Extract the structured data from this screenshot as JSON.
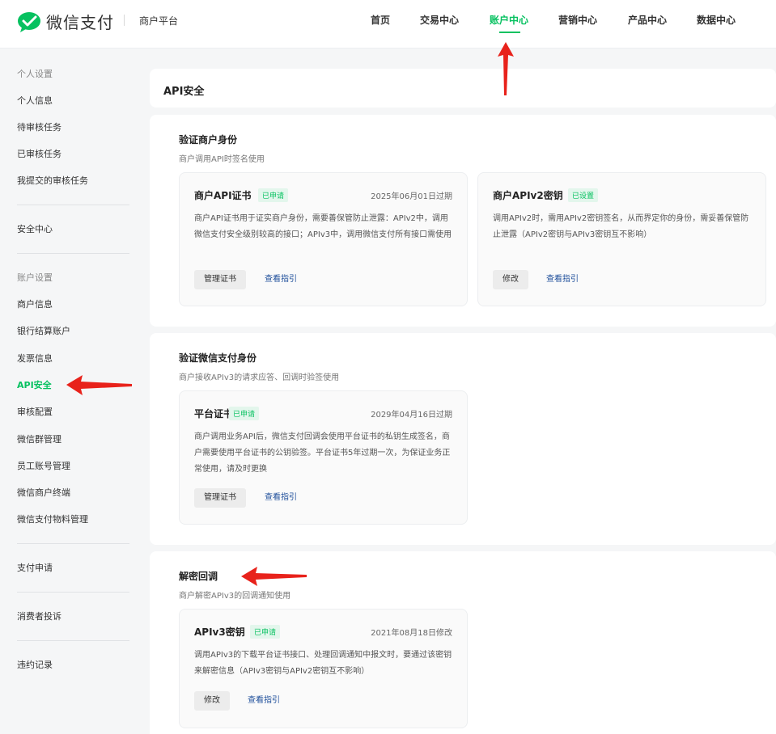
{
  "brand": {
    "logo_text": "微信支付",
    "sub_title": "商户平台"
  },
  "nav": {
    "items": [
      "首页",
      "交易中心",
      "账户中心",
      "营销中心",
      "产品中心",
      "数据中心"
    ],
    "active": "账户中心"
  },
  "sidebar": {
    "personal_group": "个人设置",
    "personal_items": [
      "个人信息",
      "待审核任务",
      "已审核任务",
      "我提交的审核任务"
    ],
    "security_center": "安全中心",
    "account_group": "账户设置",
    "account_items": [
      "商户信息",
      "银行结算账户",
      "发票信息",
      "API安全",
      "审核配置",
      "微信群管理",
      "员工账号管理",
      "微信商户终端",
      "微信支付物料管理"
    ],
    "pay_apply": "支付申请",
    "complaints": "消费者投诉",
    "violations": "违约记录",
    "active": "API安全"
  },
  "page": {
    "title": "API安全"
  },
  "sections": [
    {
      "title": "验证商户身份",
      "desc": "商户调用API时签名使用",
      "cards": [
        {
          "title": "商户API证书",
          "badge": "已申请",
          "date": "2025年06月01日过期",
          "desc": "商户API证书用于证实商户身份，需要善保管防止泄露：APIv2中，调用微信支付安全级别较高的接口；APIv3中，调用微信支付所有接口需使用",
          "button": "管理证书",
          "link": "查看指引"
        },
        {
          "title": "商户APIv2密钥",
          "badge": "已设置",
          "date": "",
          "desc": "调用APIv2时，需用APIv2密钥签名，从而界定你的身份，需妥善保管防止泄露（APIv2密钥与APIv3密钥互不影响）",
          "button": "修改",
          "link": "查看指引"
        }
      ]
    },
    {
      "title": "验证微信支付身份",
      "desc": "商户接收APIv3的请求应答、回调时验签使用",
      "cards": [
        {
          "title": "平台证书",
          "badge": "已申请",
          "date": "2029年04月16日过期",
          "desc": "商户调用业务API后，微信支付回调会使用平台证书的私钥生成签名，商户需要使用平台证书的公钥验签。平台证书5年过期一次，为保证业务正常使用，请及时更换",
          "button": "管理证书",
          "link": "查看指引"
        }
      ]
    },
    {
      "title": "解密回调",
      "desc": "商户解密APIv3的回调通知使用",
      "cards": [
        {
          "title": "APIv3密钥",
          "badge": "已申请",
          "date": "2021年08月18日修改",
          "desc": "调用APIv3的下载平台证书接口、处理回调通知中报文时，要通过该密钥来解密信息（APIv3密钥与APIv2密钥互不影响）",
          "button": "修改",
          "link": "查看指引"
        }
      ]
    }
  ],
  "colors": {
    "accent": "#07c160",
    "link": "#1f4f9b",
    "annotation_arrow": "#e8221b"
  },
  "icons": {
    "logo": "wechat-pay-logo-icon",
    "arrows": "red-annotation-arrow-icon"
  }
}
